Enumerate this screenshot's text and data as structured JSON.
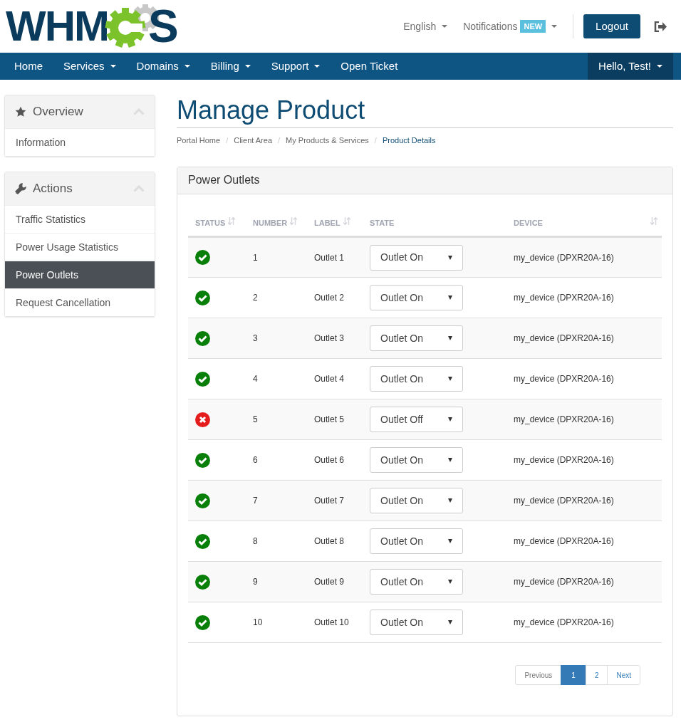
{
  "logo": {
    "left": "WHM",
    "right": "S"
  },
  "top_links": [
    {
      "label": "English"
    },
    {
      "label": "Notifications",
      "badge": "NEW"
    }
  ],
  "logout": "Logout",
  "nav": [
    {
      "label": "Home",
      "dropdown": false
    },
    {
      "label": "Services",
      "dropdown": true
    },
    {
      "label": "Domains",
      "dropdown": true
    },
    {
      "label": "Billing",
      "dropdown": true
    },
    {
      "label": "Support",
      "dropdown": true
    },
    {
      "label": "Open Ticket",
      "dropdown": false
    }
  ],
  "user_menu": "Hello, Test!",
  "sidebar": [
    {
      "title": "Overview",
      "items": [
        {
          "label": "Information",
          "selected": false
        }
      ]
    },
    {
      "title": "Actions",
      "items": [
        {
          "label": "Traffic Statistics",
          "selected": false
        },
        {
          "label": "Power Usage Statistics",
          "selected": false
        },
        {
          "label": "Power Outlets",
          "selected": true
        },
        {
          "label": "Request Cancellation",
          "selected": false
        }
      ]
    }
  ],
  "page_title": "Manage Product",
  "breadcrumb": [
    {
      "label": "Portal Home"
    },
    {
      "separator": "/",
      "label": "Client Area"
    },
    {
      "separator": "/",
      "label": "My Products & Services"
    },
    {
      "separator": "/",
      "label": "Product Details"
    }
  ],
  "panel_title": "Power Outlets",
  "table": {
    "columns": [
      "STATUS",
      "NUMBER",
      "LABEL",
      "STATE",
      "DEVICE"
    ],
    "rows": [
      {
        "on": true,
        "number": "1",
        "label": "Outlet 1",
        "state": "Outlet On",
        "device": "my_device (DPXR20A-16)"
      },
      {
        "on": true,
        "number": "2",
        "label": "Outlet 2",
        "state": "Outlet On",
        "device": "my_device (DPXR20A-16)"
      },
      {
        "on": true,
        "number": "3",
        "label": "Outlet 3",
        "state": "Outlet On",
        "device": "my_device (DPXR20A-16)"
      },
      {
        "on": true,
        "number": "4",
        "label": "Outlet 4",
        "state": "Outlet On",
        "device": "my_device (DPXR20A-16)"
      },
      {
        "on": false,
        "number": "5",
        "label": "Outlet 5",
        "state": "Outlet Off",
        "device": "my_device (DPXR20A-16)"
      },
      {
        "on": true,
        "number": "6",
        "label": "Outlet 6",
        "state": "Outlet On",
        "device": "my_device (DPXR20A-16)"
      },
      {
        "on": true,
        "number": "7",
        "label": "Outlet 7",
        "state": "Outlet On",
        "device": "my_device (DPXR20A-16)"
      },
      {
        "on": true,
        "number": "8",
        "label": "Outlet 8",
        "state": "Outlet On",
        "device": "my_device (DPXR20A-16)"
      },
      {
        "on": true,
        "number": "9",
        "label": "Outlet 9",
        "state": "Outlet On",
        "device": "my_device (DPXR20A-16)"
      },
      {
        "on": true,
        "number": "10",
        "label": "Outlet 10",
        "state": "Outlet On",
        "device": "my_device (DPXR20A-16)"
      }
    ]
  },
  "pagination": [
    {
      "label": "Previous",
      "selected": false
    },
    {
      "label": "1",
      "selected": true
    },
    {
      "label": "2",
      "selected": false
    },
    {
      "label": "Next",
      "selected": false
    }
  ]
}
